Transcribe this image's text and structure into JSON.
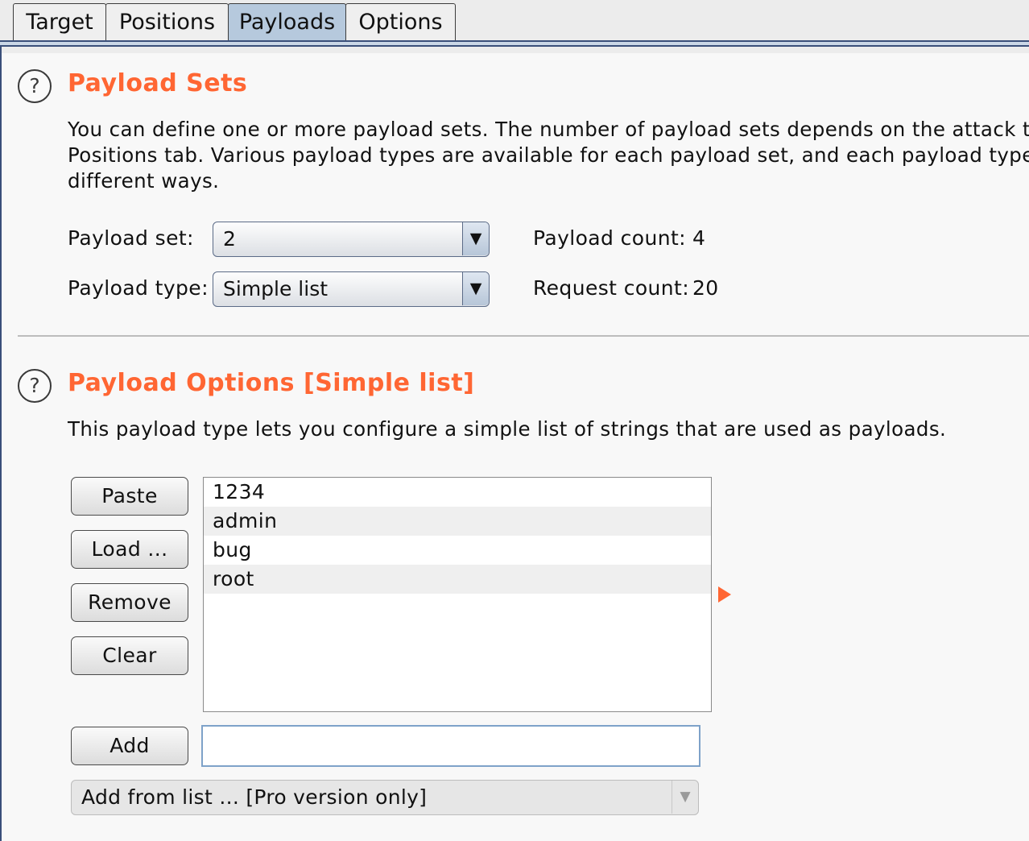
{
  "tabs": [
    {
      "label": "Target"
    },
    {
      "label": "Positions"
    },
    {
      "label": "Payloads"
    },
    {
      "label": "Options"
    }
  ],
  "help_icon_glyph": "?",
  "payload_sets": {
    "title": "Payload Sets",
    "description_lines": [
      "You can define one or more payload sets. The number of payload sets depends on the attack ty",
      "Positions tab. Various payload types are available for each payload set, and each payload type c",
      "different ways."
    ],
    "payload_set_label": "Payload set:",
    "payload_set_value": "2",
    "payload_type_label": "Payload type:",
    "payload_type_value": "Simple list",
    "payload_count_label": "Payload count:",
    "payload_count_value": "4",
    "request_count_label": "Request count:",
    "request_count_value": "20"
  },
  "payload_options": {
    "title": "Payload Options [Simple list]",
    "description": "This payload type lets you configure a simple list of strings that are used as payloads.",
    "buttons": {
      "paste": "Paste",
      "load": "Load ...",
      "remove": "Remove",
      "clear": "Clear",
      "add": "Add"
    },
    "list_items": [
      "1234",
      "admin",
      "bug",
      "root"
    ],
    "add_input_value": "",
    "add_from_list": "Add from list ... [Pro version only]"
  },
  "colors": {
    "accent": "#ff6633",
    "active_tab": "#b6c9dd",
    "border_blue": "#3a4f7a"
  },
  "icons": {
    "dropdown": "chevron-down-icon",
    "help": "help-icon",
    "marker": "triangle-right-icon"
  }
}
